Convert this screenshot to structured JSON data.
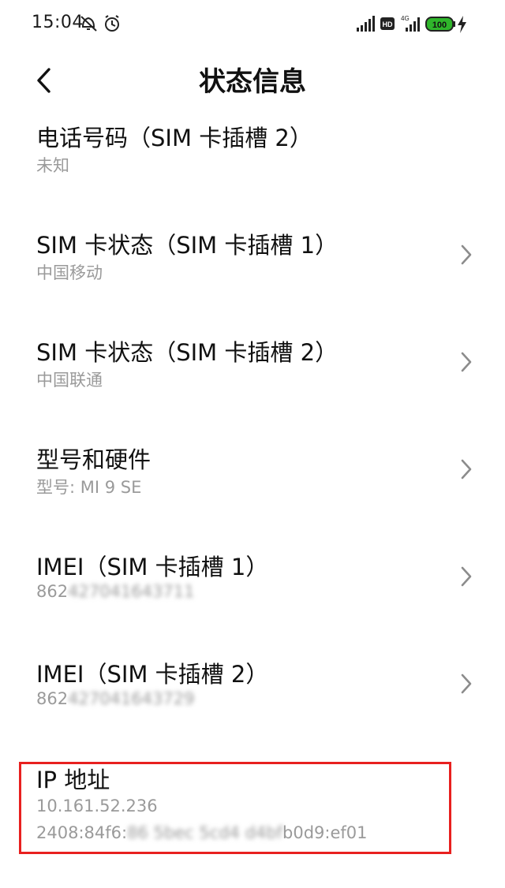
{
  "status_bar": {
    "time": "15:04",
    "left_icons": [
      "notifications-off-icon",
      "alarm-icon"
    ],
    "right_icons": [
      "signal-icon",
      "hd-icon",
      "4g-signal-icon",
      "battery-icon",
      "charging-icon"
    ],
    "hd_label": "HD",
    "network_label": "4G",
    "battery_level": "100"
  },
  "header": {
    "title": "状态信息"
  },
  "items": [
    {
      "title": "电话号码（SIM 卡插槽 2）",
      "subtitle": "未知",
      "has_chevron": false
    },
    {
      "title": "SIM 卡状态（SIM 卡插槽 1）",
      "subtitle": "中国移动",
      "has_chevron": true
    },
    {
      "title": "SIM 卡状态（SIM 卡插槽 2）",
      "subtitle": "中国联通",
      "has_chevron": true
    },
    {
      "title": "型号和硬件",
      "subtitle": "型号: MI 9 SE",
      "has_chevron": true
    },
    {
      "title": "IMEI（SIM 卡插槽 1）",
      "subtitle_visible": "862",
      "subtitle_blurred": "427041643711",
      "has_chevron": true
    },
    {
      "title": "IMEI（SIM 卡插槽 2）",
      "subtitle_visible": "862",
      "subtitle_blurred": "427041643729",
      "has_chevron": true
    }
  ],
  "ip": {
    "title": "IP 地址",
    "ipv4": "10.161.52.236",
    "ipv6_prefix": "2408:84f6:",
    "ipv6_blurred": "86 5bec 5cd4 d4bf",
    "ipv6_suffix": "b0d9:ef01"
  },
  "colors": {
    "highlight_border": "#e8201f",
    "subtitle_gray": "#9a9a9a",
    "battery_green": "#2fb62b"
  }
}
